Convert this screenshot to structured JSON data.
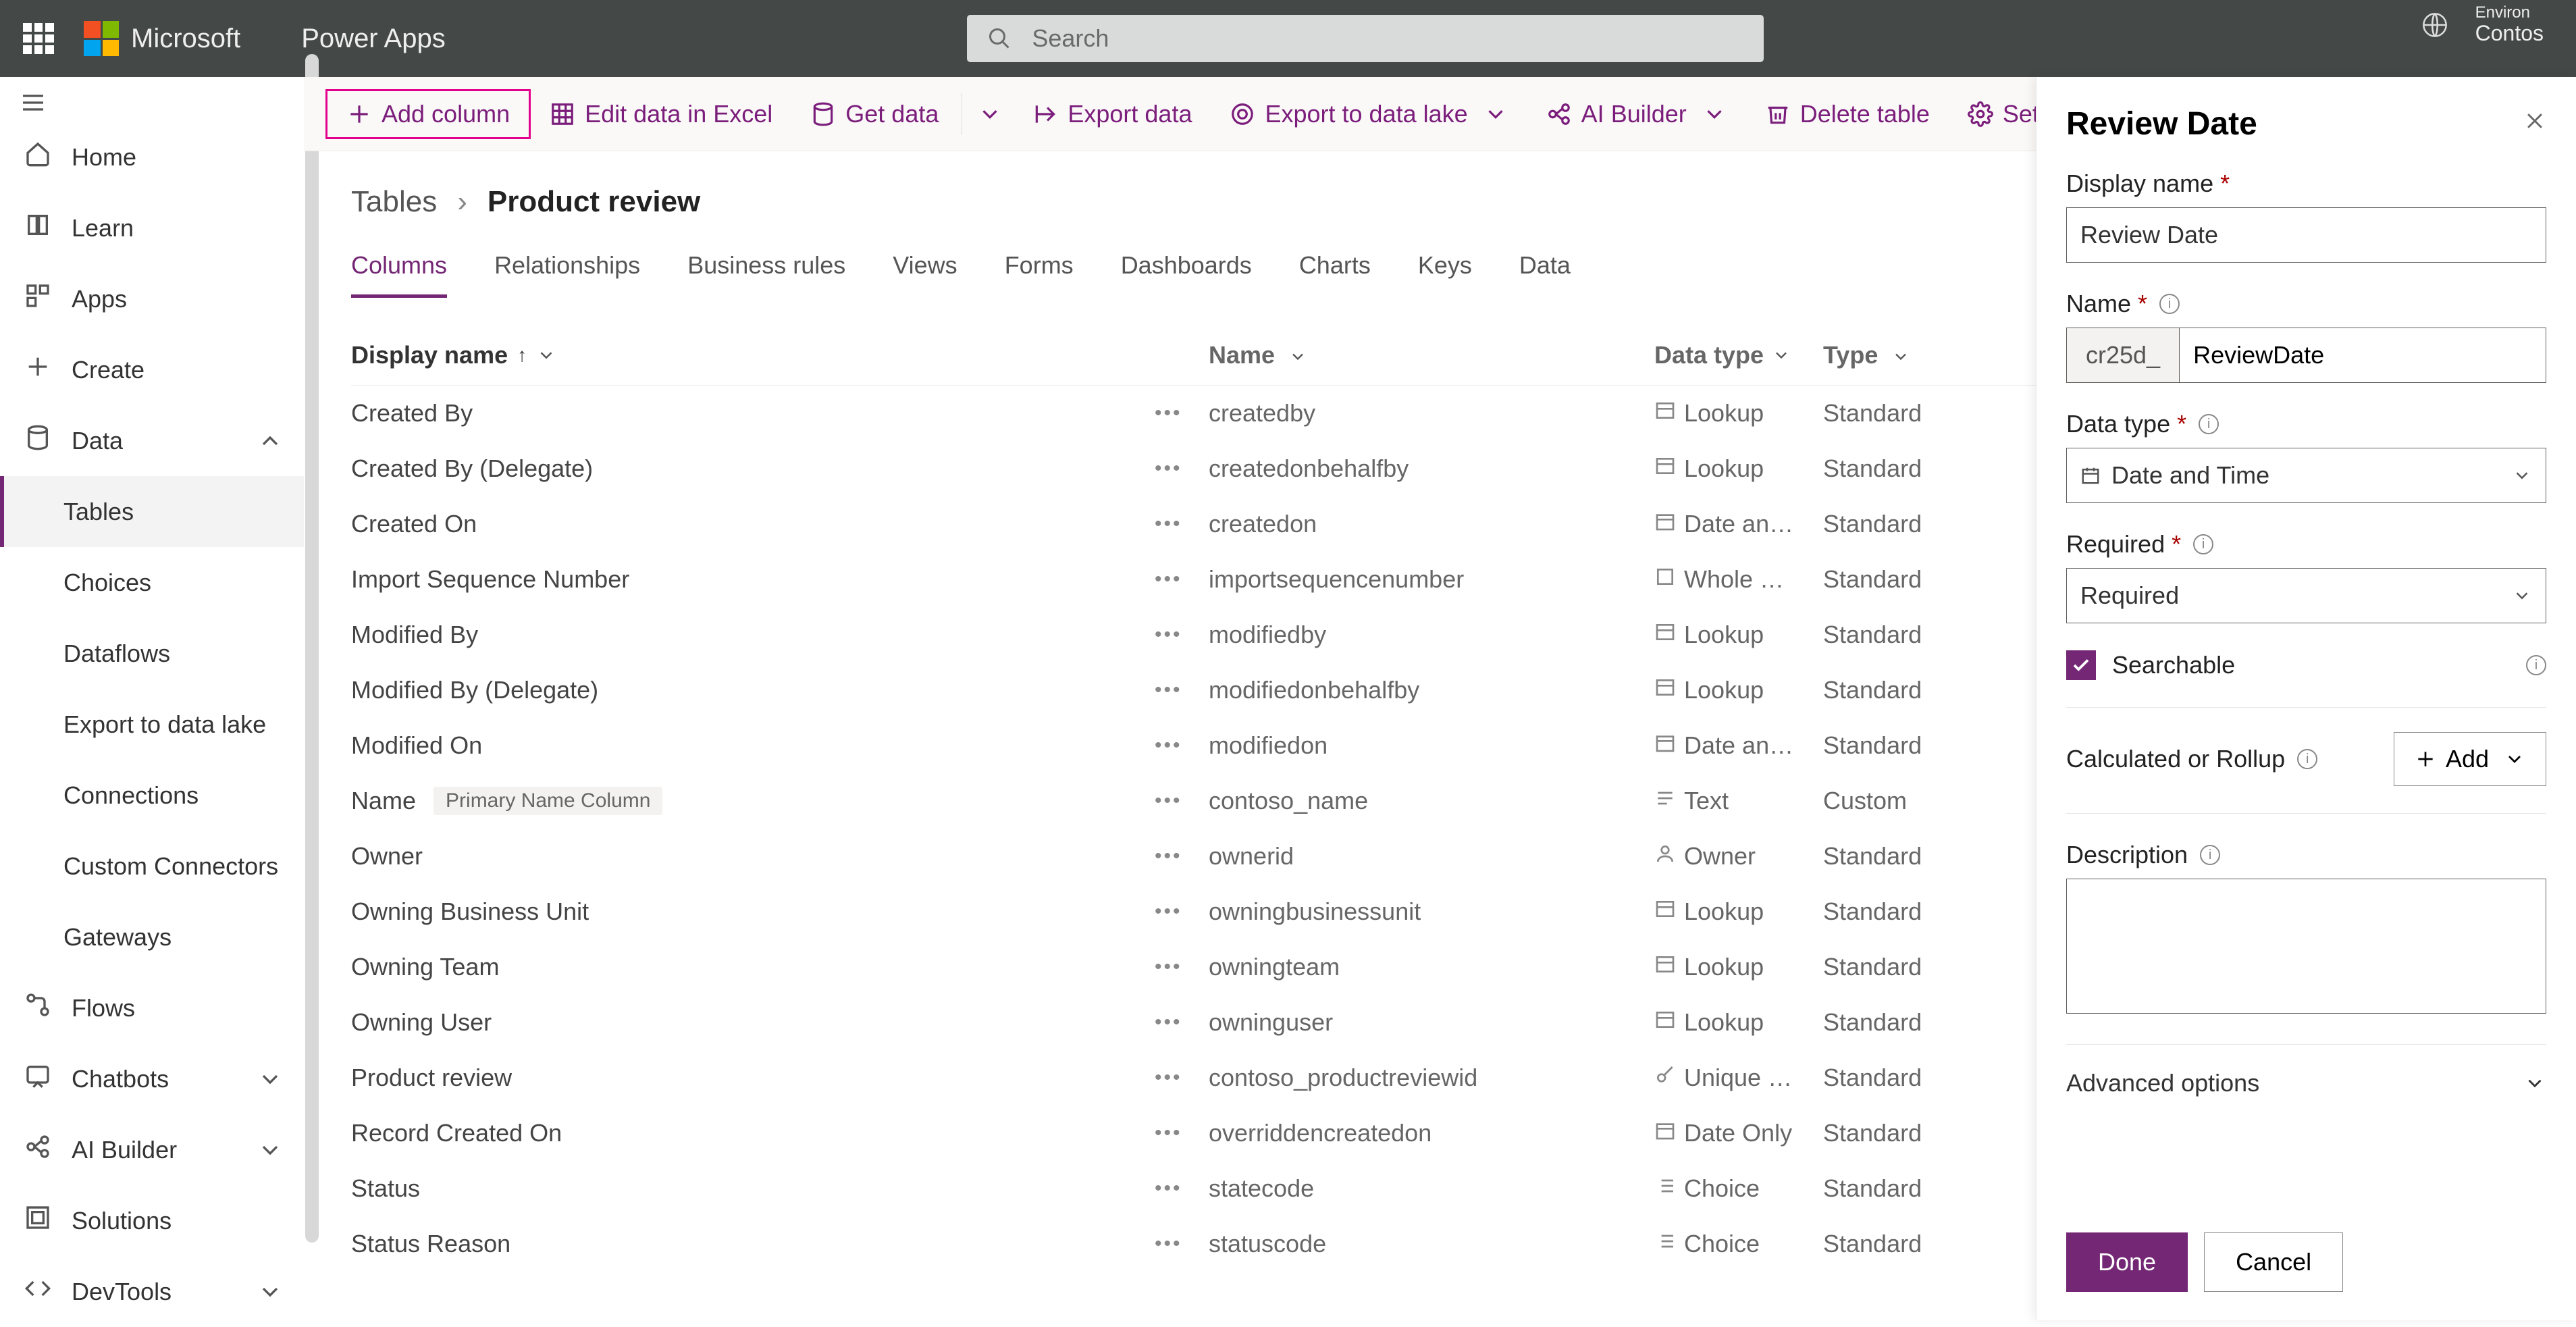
{
  "topbar": {
    "ms": "Microsoft",
    "app": "Power Apps",
    "search_placeholder": "Search",
    "env_label": "Environ",
    "env_value": "Contos"
  },
  "leftnav": {
    "items": [
      {
        "icon": "home",
        "label": "Home"
      },
      {
        "icon": "learn",
        "label": "Learn"
      },
      {
        "icon": "apps",
        "label": "Apps"
      },
      {
        "icon": "create",
        "label": "Create"
      },
      {
        "icon": "data",
        "label": "Data",
        "expanded": true
      },
      {
        "sub": true,
        "label": "Tables",
        "selected": true
      },
      {
        "sub": true,
        "label": "Choices"
      },
      {
        "sub": true,
        "label": "Dataflows"
      },
      {
        "sub": true,
        "label": "Export to data lake"
      },
      {
        "sub": true,
        "label": "Connections"
      },
      {
        "sub": true,
        "label": "Custom Connectors"
      },
      {
        "sub": true,
        "label": "Gateways"
      },
      {
        "icon": "flows",
        "label": "Flows"
      },
      {
        "icon": "chatbots",
        "label": "Chatbots",
        "chev": true
      },
      {
        "icon": "ai",
        "label": "AI Builder",
        "chev": true
      },
      {
        "icon": "solutions",
        "label": "Solutions"
      },
      {
        "icon": "devtools",
        "label": "DevTools",
        "chev": true
      }
    ]
  },
  "cmdbar": {
    "add_column": "Add column",
    "edit_excel": "Edit data in Excel",
    "get_data": "Get data",
    "export_data": "Export data",
    "export_lake": "Export to data lake",
    "ai_builder": "AI Builder",
    "delete_table": "Delete table",
    "settings": "Settin"
  },
  "breadcrumb": {
    "root": "Tables",
    "current": "Product review"
  },
  "tabs": [
    "Columns",
    "Relationships",
    "Business rules",
    "Views",
    "Forms",
    "Dashboards",
    "Charts",
    "Keys",
    "Data"
  ],
  "active_tab": 0,
  "table": {
    "headers": {
      "display": "Display name",
      "name": "Name",
      "datatype": "Data type",
      "type": "Type"
    },
    "rows": [
      {
        "display": "Created By",
        "name": "createdby",
        "datatype": "Lookup",
        "dticon": "lookup",
        "type": "Standard"
      },
      {
        "display": "Created By (Delegate)",
        "name": "createdonbehalfby",
        "datatype": "Lookup",
        "dticon": "lookup",
        "type": "Standard"
      },
      {
        "display": "Created On",
        "name": "createdon",
        "datatype": "Date an…",
        "dticon": "date",
        "type": "Standard"
      },
      {
        "display": "Import Sequence Number",
        "name": "importsequencenumber",
        "datatype": "Whole …",
        "dticon": "whole",
        "type": "Standard"
      },
      {
        "display": "Modified By",
        "name": "modifiedby",
        "datatype": "Lookup",
        "dticon": "lookup",
        "type": "Standard"
      },
      {
        "display": "Modified By (Delegate)",
        "name": "modifiedonbehalfby",
        "datatype": "Lookup",
        "dticon": "lookup",
        "type": "Standard"
      },
      {
        "display": "Modified On",
        "name": "modifiedon",
        "datatype": "Date an…",
        "dticon": "date",
        "type": "Standard"
      },
      {
        "display": "Name",
        "badge": "Primary Name Column",
        "name": "contoso_name",
        "datatype": "Text",
        "dticon": "text",
        "type": "Custom"
      },
      {
        "display": "Owner",
        "name": "ownerid",
        "datatype": "Owner",
        "dticon": "owner",
        "type": "Standard"
      },
      {
        "display": "Owning Business Unit",
        "name": "owningbusinessunit",
        "datatype": "Lookup",
        "dticon": "lookup",
        "type": "Standard"
      },
      {
        "display": "Owning Team",
        "name": "owningteam",
        "datatype": "Lookup",
        "dticon": "lookup",
        "type": "Standard"
      },
      {
        "display": "Owning User",
        "name": "owninguser",
        "datatype": "Lookup",
        "dticon": "lookup",
        "type": "Standard"
      },
      {
        "display": "Product review",
        "name": "contoso_productreviewid",
        "datatype": "Unique …",
        "dticon": "key",
        "type": "Standard"
      },
      {
        "display": "Record Created On",
        "name": "overriddencreatedon",
        "datatype": "Date Only",
        "dticon": "date",
        "type": "Standard"
      },
      {
        "display": "Status",
        "name": "statecode",
        "datatype": "Choice",
        "dticon": "choice",
        "type": "Standard"
      },
      {
        "display": "Status Reason",
        "name": "statuscode",
        "datatype": "Choice",
        "dticon": "choice",
        "type": "Standard"
      }
    ]
  },
  "sidepanel": {
    "title": "Review Date",
    "display_name_label": "Display name",
    "display_name_value": "Review Date",
    "name_label": "Name",
    "name_prefix": "cr25d_",
    "name_value": "ReviewDate",
    "datatype_label": "Data type",
    "datatype_value": "Date and Time",
    "required_label": "Required",
    "required_value": "Required",
    "searchable_label": "Searchable",
    "calc_label": "Calculated or Rollup",
    "add_label": "Add",
    "description_label": "Description",
    "advanced_label": "Advanced options",
    "done": "Done",
    "cancel": "Cancel"
  }
}
